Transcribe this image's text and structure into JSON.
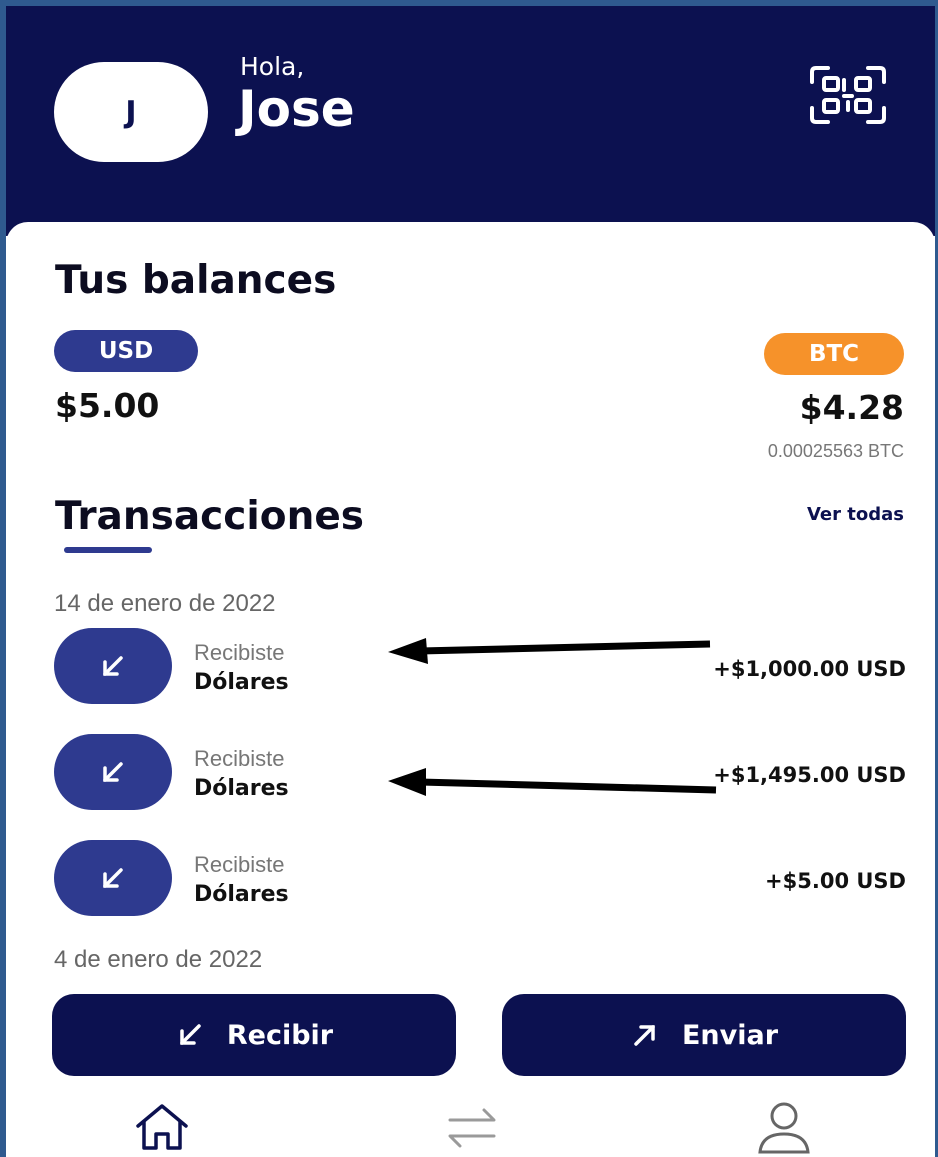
{
  "colors": {
    "header_bg": "#0c1150",
    "accent_blue": "#2e3a8f",
    "btc_orange": "#f6922a"
  },
  "header": {
    "avatar_initial": "J",
    "greeting": "Hola,",
    "name": "Jose",
    "qr_icon": "qr-scan-icon"
  },
  "balances": {
    "title": "Tus balances",
    "usd": {
      "label": "USD",
      "amount": "$5.00"
    },
    "btc": {
      "label": "BTC",
      "amount": "$4.28",
      "crypto_amount": "0.00025563 BTC"
    }
  },
  "transactions": {
    "title": "Transacciones",
    "see_all": "Ver todas",
    "groups": [
      {
        "date": "14 de enero de 2022",
        "items": [
          {
            "type": "Recibiste",
            "currency": "Dólares",
            "amount": "+$1,000.00 USD"
          },
          {
            "type": "Recibiste",
            "currency": "Dólares",
            "amount": "+$1,495.00 USD"
          },
          {
            "type": "Recibiste",
            "currency": "Dólares",
            "amount": "+$5.00 USD"
          }
        ]
      },
      {
        "date": "4 de enero de 2022",
        "items": []
      }
    ]
  },
  "actions": {
    "receive": {
      "label": "Recibir",
      "icon": "arrow-down-left-icon"
    },
    "send": {
      "label": "Enviar",
      "icon": "arrow-up-right-icon"
    }
  },
  "bottom_nav": {
    "items": [
      {
        "icon": "home-icon"
      },
      {
        "icon": "transfer-icon"
      },
      {
        "icon": "profile-icon"
      }
    ]
  }
}
